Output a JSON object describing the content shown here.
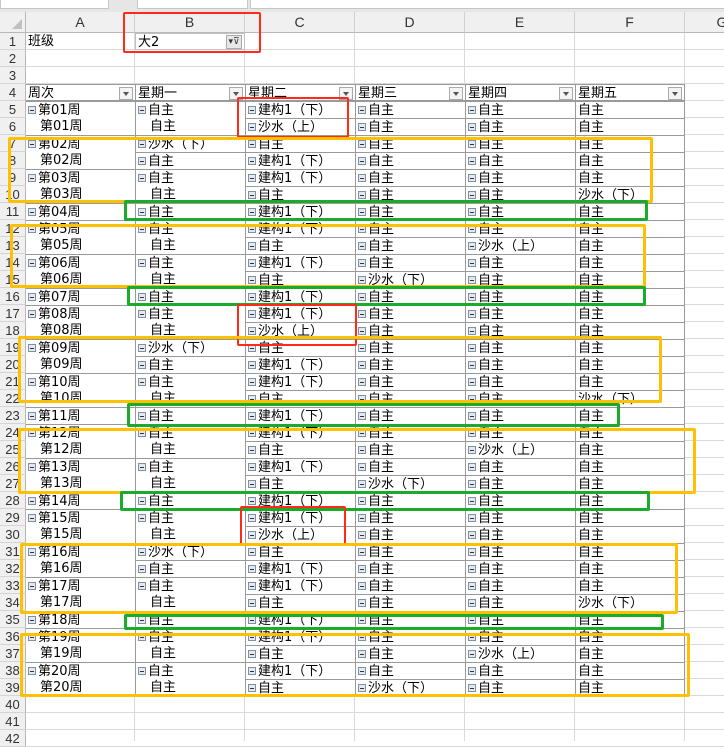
{
  "colors": {
    "red": "#ff2a1a",
    "orange": "#ffc000",
    "green": "#1aab2a"
  },
  "columns": [
    "A",
    "B",
    "C",
    "D",
    "E",
    "F",
    "G"
  ],
  "row_numbers": [
    1,
    2,
    3,
    4,
    5,
    6,
    7,
    8,
    9,
    10,
    11,
    12,
    13,
    14,
    15,
    16,
    17,
    18,
    19,
    20,
    21,
    22,
    23,
    24,
    25,
    26,
    27,
    28,
    29,
    30,
    31,
    32,
    33,
    34,
    35,
    36,
    37,
    38,
    39,
    40,
    41,
    42
  ],
  "filter": {
    "label": "班级",
    "value": "大2"
  },
  "pivot_headers": [
    "周次",
    "星期一",
    "星期二",
    "星期三",
    "星期四",
    "星期五"
  ],
  "rows": [
    [
      "第01周",
      "自主",
      "建构1（下）",
      "自主",
      "自主",
      "自主"
    ],
    [
      "第01周",
      "自主",
      "沙水（上）",
      "自主",
      "自主",
      "自主"
    ],
    [
      "第02周",
      "沙水（下）",
      "自主",
      "自主",
      "自主",
      "自主"
    ],
    [
      "第02周",
      "自主",
      "建构1（下）",
      "自主",
      "自主",
      "自主"
    ],
    [
      "第03周",
      "自主",
      "建构1（下）",
      "自主",
      "自主",
      "自主"
    ],
    [
      "第03周",
      "自主",
      "自主",
      "自主",
      "自主",
      "沙水（下）"
    ],
    [
      "第04周",
      "自主",
      "建构1（下）",
      "自主",
      "自主",
      "自主"
    ],
    [
      "第05周",
      "自主",
      "建构1（下）",
      "自主",
      "自主",
      "自主"
    ],
    [
      "第05周",
      "自主",
      "自主",
      "自主",
      "沙水（上）",
      "自主"
    ],
    [
      "第06周",
      "自主",
      "建构1（下）",
      "自主",
      "自主",
      "自主"
    ],
    [
      "第06周",
      "自主",
      "自主",
      "沙水（下）",
      "自主",
      "自主"
    ],
    [
      "第07周",
      "自主",
      "建构1（下）",
      "自主",
      "自主",
      "自主"
    ],
    [
      "第08周",
      "自主",
      "建构1（下）",
      "自主",
      "自主",
      "自主"
    ],
    [
      "第08周",
      "自主",
      "沙水（上）",
      "自主",
      "自主",
      "自主"
    ],
    [
      "第09周",
      "沙水（下）",
      "自主",
      "自主",
      "自主",
      "自主"
    ],
    [
      "第09周",
      "自主",
      "建构1（下）",
      "自主",
      "自主",
      "自主"
    ],
    [
      "第10周",
      "自主",
      "建构1（下）",
      "自主",
      "自主",
      "自主"
    ],
    [
      "第10周",
      "自主",
      "自主",
      "自主",
      "自主",
      "沙水（下）"
    ],
    [
      "第11周",
      "自主",
      "建构1（下）",
      "自主",
      "自主",
      "自主"
    ],
    [
      "第12周",
      "自主",
      "建构1（下）",
      "自主",
      "自主",
      "自主"
    ],
    [
      "第12周",
      "自主",
      "自主",
      "自主",
      "沙水（上）",
      "自主"
    ],
    [
      "第13周",
      "自主",
      "建构1（下）",
      "自主",
      "自主",
      "自主"
    ],
    [
      "第13周",
      "自主",
      "自主",
      "沙水（下）",
      "自主",
      "自主"
    ],
    [
      "第14周",
      "自主",
      "建构1（下）",
      "自主",
      "自主",
      "自主"
    ],
    [
      "第15周",
      "自主",
      "建构1（下）",
      "自主",
      "自主",
      "自主"
    ],
    [
      "第15周",
      "自主",
      "沙水（上）",
      "自主",
      "自主",
      "自主"
    ],
    [
      "第16周",
      "沙水（下）",
      "自主",
      "自主",
      "自主",
      "自主"
    ],
    [
      "第16周",
      "自主",
      "建构1（下）",
      "自主",
      "自主",
      "自主"
    ],
    [
      "第17周",
      "自主",
      "建构1（下）",
      "自主",
      "自主",
      "自主"
    ],
    [
      "第17周",
      "自主",
      "自主",
      "自主",
      "自主",
      "沙水（下）"
    ],
    [
      "第18周",
      "自主",
      "建构1（下）",
      "自主",
      "自主",
      "自主"
    ],
    [
      "第19周",
      "自主",
      "建构1（下）",
      "自主",
      "自主",
      "自主"
    ],
    [
      "第19周",
      "自主",
      "自主",
      "自主",
      "沙水（上）",
      "自主"
    ],
    [
      "第20周",
      "自主",
      "建构1（下）",
      "自主",
      "自主",
      "自主"
    ],
    [
      "第20周",
      "自主",
      "自主",
      "沙水（下）",
      "自主",
      "自主"
    ]
  ]
}
